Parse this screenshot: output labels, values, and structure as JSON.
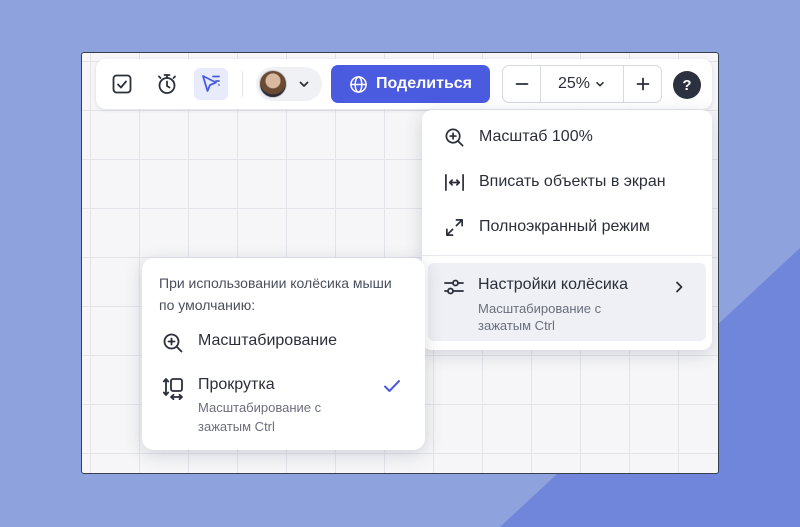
{
  "toolbar": {
    "tools": [
      {
        "icon": "checkbox-icon"
      },
      {
        "icon": "stopwatch-icon"
      },
      {
        "icon": "cursor-select-icon",
        "active": true
      }
    ],
    "avatar": {
      "icon": "user-avatar"
    },
    "share": {
      "label": "Поделиться",
      "icon": "globe-icon"
    },
    "zoom": {
      "minus": "−",
      "value": "25%",
      "plus": "+"
    },
    "help": "?"
  },
  "zoom_menu": {
    "items": [
      {
        "label": "Масштаб 100%",
        "icon": "zoom-in-icon"
      },
      {
        "label": "Вписать объекты в экран",
        "icon": "fit-width-icon"
      },
      {
        "label": "Полноэкранный режим",
        "icon": "fullscreen-icon"
      }
    ],
    "wheel_settings": {
      "label": "Настройки колёсика",
      "sublabel": "Масштабирование с зажатым Ctrl",
      "icon": "sliders-icon"
    }
  },
  "wheel_popover": {
    "intro": "При использовании колёсика мыши по умолчанию:",
    "options": [
      {
        "label": "Масштабирование",
        "icon": "zoom-in-icon"
      },
      {
        "label": "Прокрутка",
        "sublabel": "Масштабирование с зажатым Ctrl",
        "icon": "scroll-icon",
        "selected": true
      }
    ]
  },
  "colors": {
    "accent": "#4b5be0",
    "background": "#8ea3dd",
    "background_wedge": "#6f86da",
    "canvas": "#f6f6f8"
  }
}
